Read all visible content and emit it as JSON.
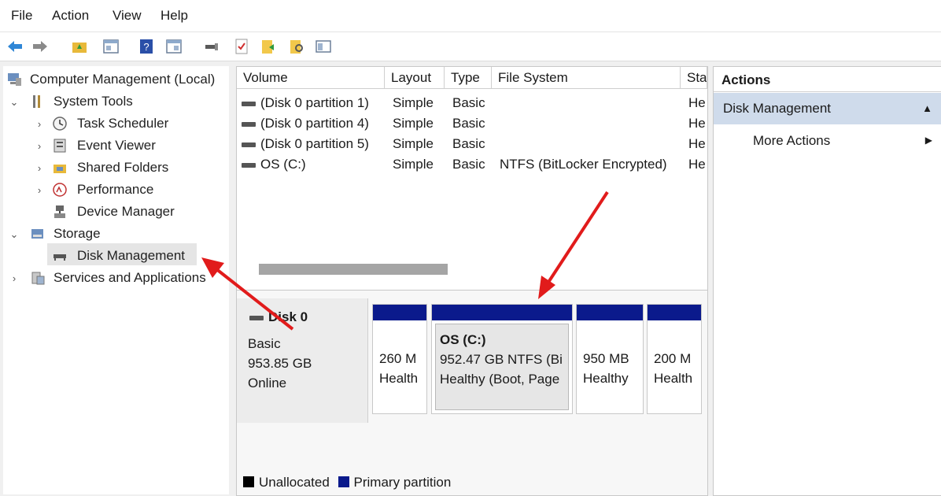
{
  "menu": [
    "File",
    "Action",
    "View",
    "Help"
  ],
  "tree": {
    "root": "Computer Management (Local)",
    "system_tools": "System Tools",
    "task_scheduler": "Task Scheduler",
    "event_viewer": "Event Viewer",
    "shared_folders": "Shared Folders",
    "performance": "Performance",
    "device_manager": "Device Manager",
    "storage": "Storage",
    "disk_management": "Disk Management",
    "services": "Services and Applications"
  },
  "volumes": {
    "columns": [
      "Volume",
      "Layout",
      "Type",
      "File System",
      "Sta"
    ],
    "rows": [
      {
        "volume": "(Disk 0 partition 1)",
        "layout": "Simple",
        "type": "Basic",
        "fs": "",
        "status": "He"
      },
      {
        "volume": "(Disk 0 partition 4)",
        "layout": "Simple",
        "type": "Basic",
        "fs": "",
        "status": "He"
      },
      {
        "volume": "(Disk 0 partition 5)",
        "layout": "Simple",
        "type": "Basic",
        "fs": "",
        "status": "He"
      },
      {
        "volume": "OS (C:)",
        "layout": "Simple",
        "type": "Basic",
        "fs": "NTFS (BitLocker Encrypted)",
        "status": "He"
      }
    ]
  },
  "disk": {
    "name": "Disk 0",
    "type": "Basic",
    "size": "953.85 GB",
    "state": "Online",
    "partitions": [
      {
        "line1": "",
        "line2": "260 M",
        "line3": "Health"
      },
      {
        "line1": "OS  (C:)",
        "line2": "952.47 GB NTFS (Bi",
        "line3": "Healthy (Boot, Page"
      },
      {
        "line1": "",
        "line2": "950 MB",
        "line3": "Healthy"
      },
      {
        "line1": "",
        "line2": "200 M",
        "line3": "Health"
      }
    ]
  },
  "legend": {
    "unallocated": "Unallocated",
    "primary": "Primary partition"
  },
  "actions": {
    "title": "Actions",
    "section": "Disk Management",
    "more": "More Actions"
  },
  "colors": {
    "primary": "#0b1a8c",
    "unallocated": "#000000",
    "arrow": "#e11b1b",
    "action_section": "#cfdbeb"
  }
}
